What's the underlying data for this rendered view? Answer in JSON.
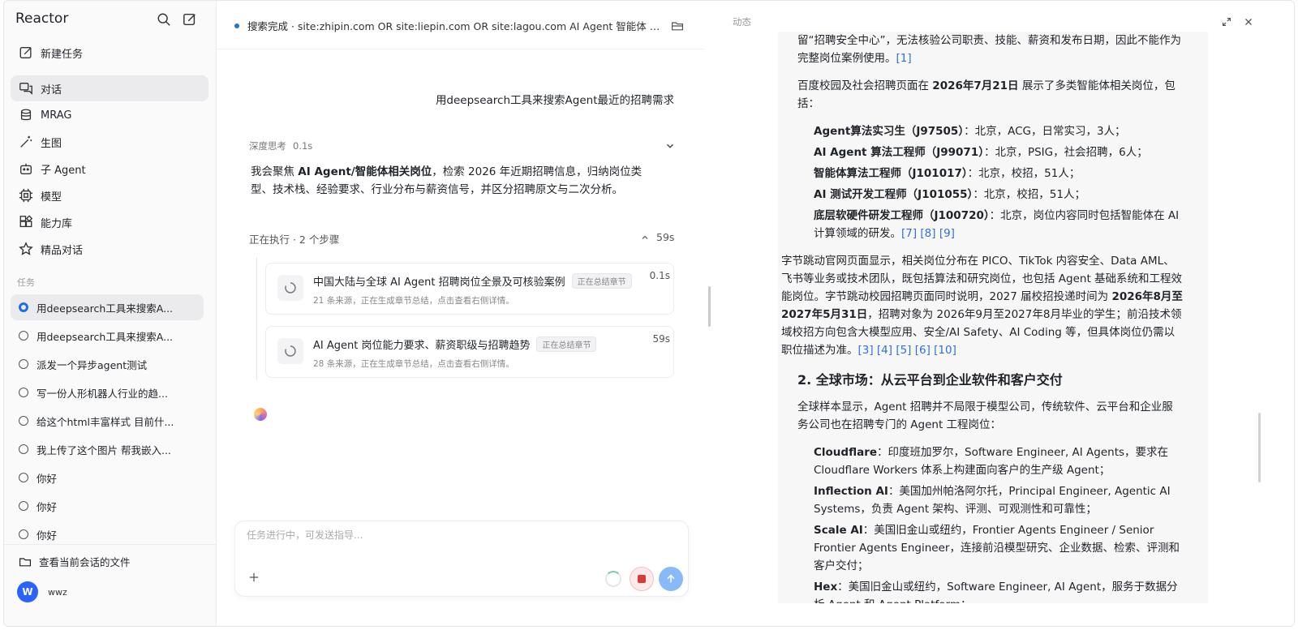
{
  "app": {
    "brand": "Reactor"
  },
  "sidebar": {
    "new_task": "新建任务",
    "nav": [
      {
        "label": "对话",
        "icon": "chat-icon"
      },
      {
        "label": "MRAG",
        "icon": "database-icon"
      },
      {
        "label": "生图",
        "icon": "magic-wand-icon"
      },
      {
        "label": "子 Agent",
        "icon": "robot-icon"
      },
      {
        "label": "模型",
        "icon": "chip-icon"
      },
      {
        "label": "能力库",
        "icon": "blocks-icon"
      },
      {
        "label": "精品对话",
        "icon": "star-icon"
      }
    ],
    "tasks_label": "任务",
    "tasks": [
      "用deepsearch工具来搜索A...",
      "用deepsearch工具来搜索A...",
      "派发一个异步agent测试",
      "写一份人形机器人行业的趋...",
      "给这个html丰富样式 目前什...",
      "我上传了这个图片 帮我嵌入...",
      "你好",
      "你好",
      "你好"
    ],
    "files_link": "查看当前会话的文件",
    "user_initial": "W",
    "user_name": "wwz"
  },
  "chat": {
    "status_prefix": "搜索完成 · ",
    "status_query": "site:zhipin.com OR site:liepin.com OR site:lagou.com AI Agent 智能体 招聘 Pyt...",
    "user_message": "用deepsearch工具来搜索Agent最近的招聘需求",
    "thinking_label": "深度思考",
    "thinking_time": "0.1s",
    "thinking_pre": "我会聚焦 ",
    "thinking_bold": "AI Agent/智能体相关岗位",
    "thinking_post": "，检索 2026 年近期招聘信息，归纳岗位类型、技术栈、经验要求、行业分布与薪资信号，并区分招聘原文与二次分析。",
    "exec_label": "正在执行 · 2 个步骤",
    "exec_time": "59s",
    "steps": [
      {
        "title": "中国大陆与全球 AI Agent 招聘岗位全景及可核验案例",
        "badge": "正在总结章节",
        "sub": "21 条来源，正在生成章节总结，点击查看右侧详情。",
        "duration": "0.1s"
      },
      {
        "title": "AI Agent 岗位能力要求、薪资职级与招聘趋势",
        "badge": "正在总结章节",
        "sub": "28 条来源，正在生成章节总结，点击查看右侧详情。",
        "duration": "59s"
      }
    ],
    "composer_placeholder": "任务进行中，可发送指导..."
  },
  "panel": {
    "title": "动态",
    "p0": "留“招聘安全中心”，无法核验公司职责、技能、薪资和发布日期，因此不能作为完整岗位案例使用。",
    "p0_refs": "[1]",
    "p1_pre": "百度校园及社会招聘页面在 ",
    "p1_bold": "2026年7月21日",
    "p1_post": " 展示了多类智能体相关岗位，包括：",
    "jobs": [
      {
        "name": "Agent算法实习生（J97505）",
        "desc": "：北京，ACG，日常实习，3人；"
      },
      {
        "name": "AI Agent 算法工程师（J99071）",
        "desc": "：北京，PSIG，社会招聘，6人；"
      },
      {
        "name": "智能体算法工程师（J101017）",
        "desc": "：北京，校招，51人；"
      },
      {
        "name": "AI 测试开发工程师（J101055）",
        "desc": "：北京，校招，51人；"
      },
      {
        "name": "底层软硬件研发工程师（J100720）",
        "desc": "：北京，岗位内容同时包括智能体在 AI 计算领域的研发。"
      }
    ],
    "jobs_refs": "[7] [8] [9]",
    "p2_pre": "字节跳动官网页面显示，相关岗位分布在 PICO、TikTok 内容安全、Data AML、飞书等业务或技术团队，既包括算法和研究岗位，也包括 Agent 基础系统和工程效能岗位。字节跳动校园招聘页面同时说明，2027 届校招投递时间为 ",
    "p2_bold": "2026年8月至2027年5月31日",
    "p2_post": "，招聘对象为 2026年9月至2027年8月毕业的学生；前沿技术领域校招方向包含大模型应用、安全/AI Safety、AI Coding 等，但具体岗位仍需以职位描述为准。",
    "p2_refs": "[3] [4] [5] [6] [10]",
    "h2": "2. 全球市场：从云平台到企业软件和客户交付",
    "p3": "全球样本显示，Agent 招聘并不局限于模型公司，传统软件、云平台和企业服务公司也在招聘专门的 Agent 工程岗位：",
    "global": [
      {
        "name": "Cloudflare",
        "desc": "：印度班加罗尔，Software Engineer, AI Agents，要求在 Cloudflare Workers 体系上构建面向客户的生产级 Agent；"
      },
      {
        "name": "Inflection AI",
        "desc": "：美国加州帕洛阿尔托，Principal Engineer, Agentic AI Systems，负责 Agent 架构、评测、可观测性和可靠性；"
      },
      {
        "name": "Scale AI",
        "desc": "：美国旧金山或纽约，Frontier Agents Engineer / Senior Frontier Agents Engineer，连接前沿模型研究、企业数据、检索、评测和客户交付；"
      },
      {
        "name": "Hex",
        "desc": "：美国旧金山或纽约，Software Engineer, AI Agent，服务于数据分析 Agent 和 Agent Platform；"
      }
    ]
  }
}
